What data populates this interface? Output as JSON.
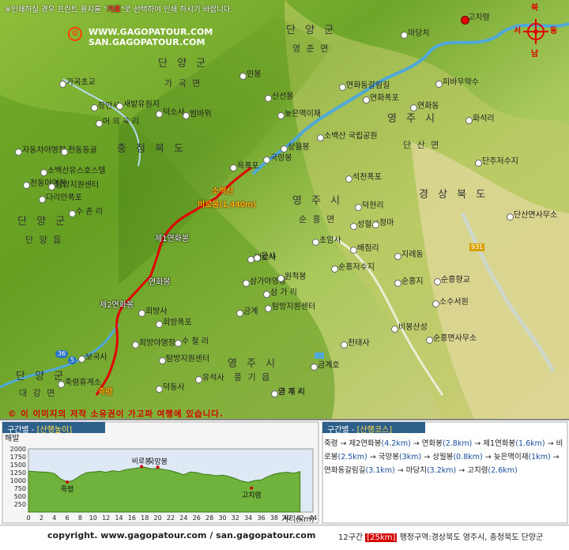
{
  "notice": {
    "prefix": "※인쇄하실 경우 프린트 용지를 \"",
    "highlight": "가로",
    "suffix": "\"로 선택하여 인쇄 하시기 바랍니다."
  },
  "site": {
    "copyright_symbol": "©",
    "url1": "WWW.GAGOPATOUR.COM",
    "url2": "SAN.GAGOPATOUR.COM"
  },
  "compass": {
    "n": "북",
    "s": "남",
    "w": "서",
    "e": "동"
  },
  "map": {
    "regions": [
      {
        "text": "단 양 군",
        "cls": "big"
      },
      {
        "text": "영 춘 면",
        "cls": "mid"
      },
      {
        "text": "단 양 군",
        "cls": "big"
      },
      {
        "text": "가 곡 면",
        "cls": "mid"
      },
      {
        "text": "충 청 북 도",
        "cls": "big"
      },
      {
        "text": "영 주 시",
        "cls": "big"
      },
      {
        "text": "단 산 면",
        "cls": "mid"
      },
      {
        "text": "경 상 북 도",
        "cls": "big"
      },
      {
        "text": "영 주 시",
        "cls": "big"
      },
      {
        "text": "순 흥 면",
        "cls": "mid"
      },
      {
        "text": "단 양 군",
        "cls": "big"
      },
      {
        "text": "단 양 읍",
        "cls": "mid"
      },
      {
        "text": "영 주 시",
        "cls": "big"
      },
      {
        "text": "풍 기 읍",
        "cls": "mid"
      },
      {
        "text": "단 양 군",
        "cls": "big"
      },
      {
        "text": "대 강 면",
        "cls": "mid"
      }
    ],
    "places": [
      "고치령",
      "마당치",
      "민봉",
      "연화동갈림길",
      "피바우약수",
      "신선봉",
      "늦은맥이재",
      "연화폭포",
      "연화동",
      "화석리",
      "소백산 국립공원",
      "상월봉",
      "국망봉",
      "단주저수지",
      "석천폭포",
      "덕현리",
      "단산면사무소",
      "성혈사",
      "청마",
      "초암사",
      "배점리",
      "지례동",
      "비로사",
      "순흥저수지",
      "순흥향교",
      "삼가야영장",
      "삼 가 리",
      "순흥지",
      "소수서원",
      "금계",
      "탐방지원센터",
      "희방사",
      "비봉산성",
      "희방폭포",
      "순흥면사무소",
      "수 철 리",
      "희방야영장",
      "천태사",
      "탐방지원센터",
      "금계호",
      "유석사",
      "영 주 시",
      "금 계 리",
      "가곡초교",
      "장안사",
      "새밭유원지",
      "덕소사",
      "어 의 곡 리",
      "범바위",
      "자동차야영장",
      "천동동굴",
      "소백산유스호스텔",
      "천동야영장",
      "탐방지원센터",
      "다리안폭포",
      "수 촌 리",
      "보국사",
      "죽령휴게소",
      "덕동사",
      "윤사",
      "원적봉",
      "욕폭포"
    ],
    "route_labels": {
      "birobong": "소백산",
      "birobong2": "비로봉(1,440m)",
      "je1": "제1연화봉",
      "yeonhwa": "연화봉",
      "je2": "제2연화봉",
      "jukryeong": "죽령"
    },
    "roads": {
      "r36": "36",
      "r5": "5",
      "r931": "931"
    }
  },
  "copyright_note": "© 이 이미지의 저작 소유권이 가고파 여행에 있습니다.",
  "elevation_panel": {
    "header_prefix": "구간별 - ",
    "header_title": "[산행높이]",
    "ylabel": "해발",
    "xlabel": "거리",
    "xunit": "(km)"
  },
  "course_panel": {
    "header_prefix": "구간별 - ",
    "header_title": "[산행코스]",
    "steps": [
      {
        "name": "죽령",
        "km": ""
      },
      {
        "name": "제2연화봉",
        "km": "(4.2km)"
      },
      {
        "name": "연화봉",
        "km": "(2.8km)"
      },
      {
        "name": "제1연화봉",
        "km": "(1.6km)"
      },
      {
        "name": "비로봉",
        "km": "(2.5km)"
      },
      {
        "name": "국망봉",
        "km": "(3km)"
      },
      {
        "name": "상월봉",
        "km": "(0.8km)"
      },
      {
        "name": "늦은맥이재",
        "km": "(1km)"
      },
      {
        "name": "연화동갈림길",
        "km": "(3.1km)"
      },
      {
        "name": "마당치",
        "km": "(3.2km)"
      },
      {
        "name": "고치령",
        "km": "(2.6km)"
      }
    ]
  },
  "footer": {
    "url": "copyright.  www.gagopatour.com / san.gagopatour.com",
    "section": "12구간",
    "length": "[25km]",
    "admin": "행정구역:경상북도 영주시, 충청북도 단양군"
  },
  "chart_data": {
    "type": "area",
    "title": "",
    "ylabel": "해발",
    "xlabel": "거리(km)",
    "xlim": [
      0,
      44
    ],
    "ylim": [
      0,
      2000
    ],
    "xticks": [
      0,
      2,
      4,
      6,
      8,
      10,
      12,
      14,
      16,
      18,
      20,
      22,
      24,
      26,
      28,
      30,
      32,
      34,
      36,
      38,
      40,
      42,
      44
    ],
    "yticks": [
      250,
      500,
      750,
      1000,
      1250,
      1500,
      1750,
      2000
    ],
    "grid": false,
    "series": [
      {
        "x": [
          0,
          1,
          2,
          3,
          4,
          5,
          6,
          7,
          8,
          9,
          10,
          11,
          12,
          13,
          14,
          15,
          16,
          17,
          18,
          19,
          20,
          21,
          22,
          23,
          24,
          25,
          26,
          27,
          28,
          29,
          30,
          31,
          32,
          33,
          34,
          35,
          36,
          37,
          38,
          39,
          40,
          41,
          42
        ],
        "values": [
          1300,
          1280,
          1270,
          1260,
          1220,
          1050,
          950,
          1010,
          1150,
          1250,
          1270,
          1290,
          1260,
          1310,
          1280,
          1340,
          1370,
          1400,
          1420,
          1370,
          1380,
          1340,
          1310,
          1250,
          1180,
          1270,
          1250,
          1200,
          1180,
          1150,
          1170,
          1130,
          1060,
          980,
          940,
          1000,
          1020,
          1120,
          1200,
          1240,
          1260,
          1230,
          1280
        ]
      }
    ],
    "annotations": [
      {
        "label": "죽령",
        "x": 6,
        "y": 950
      },
      {
        "label": "비로봉",
        "x": 17.5,
        "y": 1440
      },
      {
        "label": "국망봉",
        "x": 20,
        "y": 1420
      },
      {
        "label": "고치령",
        "x": 34.5,
        "y": 760
      }
    ]
  }
}
